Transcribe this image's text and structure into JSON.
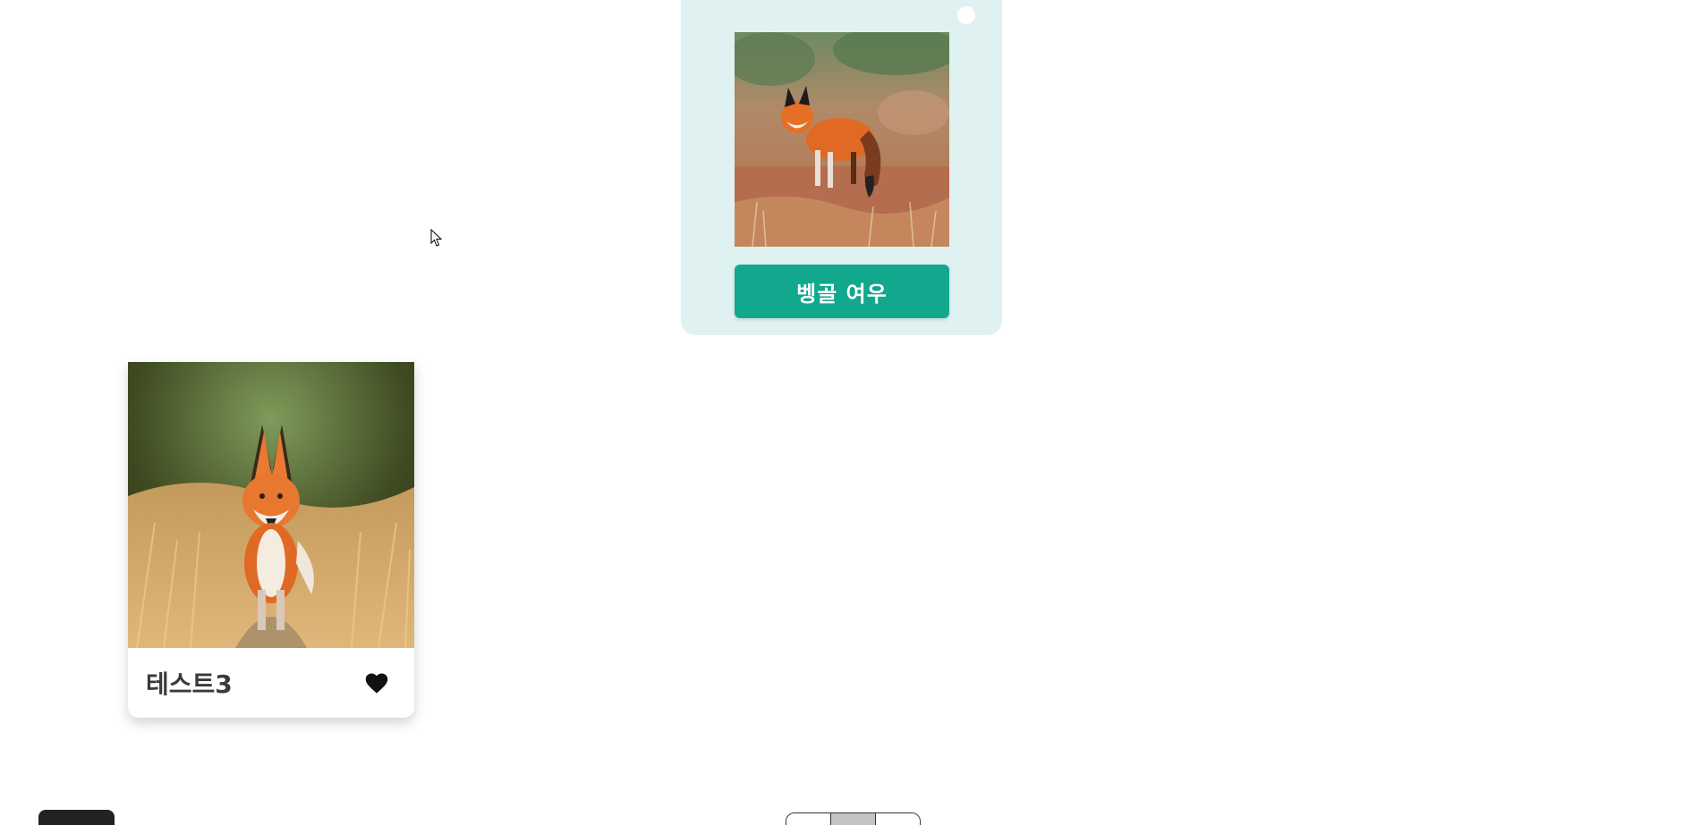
{
  "featured": {
    "button_label": "벵골 여우",
    "image_icon": "fox-in-field-illustration",
    "dot_icon": "white-dot"
  },
  "grid": {
    "cards": [
      {
        "title": "테스트3",
        "image_icon": "fox-walking-in-grass-photo",
        "favorite_icon": "heart-icon",
        "favorited": true
      }
    ]
  },
  "pagination": {
    "pages": 3,
    "active_index": 1
  },
  "colors": {
    "featured_bg": "#e0f1f1",
    "accent": "#12a88e",
    "dark_button": "#222222",
    "active_page": "#c4c4c4"
  }
}
